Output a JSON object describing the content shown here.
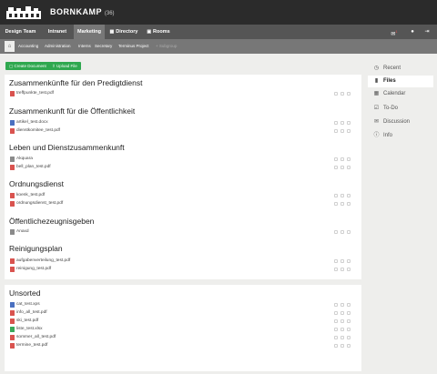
{
  "header": {
    "brand": "BORNKAMP",
    "brand_suffix": "(36)"
  },
  "mainnav": {
    "items": [
      {
        "label": "Design Team"
      },
      {
        "label": "Intranet"
      },
      {
        "label": "Marketing",
        "active": true
      },
      {
        "label": "Directory",
        "icon": "book-icon"
      },
      {
        "label": "Rooms",
        "icon": "rooms-icon"
      }
    ],
    "mail_badge": "1"
  },
  "subnav": {
    "items": [
      {
        "label": "Accounting"
      },
      {
        "label": "Administration"
      },
      {
        "label": "Interns"
      },
      {
        "label": "Secretary"
      },
      {
        "label": "Terminus Project"
      },
      {
        "label": "Subgroup",
        "disabled": true
      }
    ]
  },
  "actions": {
    "create_label": "Create Document",
    "upload_label": "Upload File"
  },
  "groups": [
    {
      "title": "Zusammenkünfte für den Predigtdienst",
      "files": [
        {
          "name": "treffpunkte_test.pdf",
          "type": "pdf"
        }
      ]
    },
    {
      "title": "Zusammenkunft für die Öffentlichkeit",
      "files": [
        {
          "name": "artikel_test.docx",
          "type": "doc"
        },
        {
          "name": "dienstkomitee_test.pdf",
          "type": "pdf"
        }
      ]
    },
    {
      "title": "Leben und Dienstzusammenkunft",
      "files": [
        {
          "name": "Akquara",
          "type": "generic"
        },
        {
          "name": "bell_plan_test.pdf",
          "type": "pdf"
        }
      ]
    },
    {
      "title": "Ordnungsdienst",
      "files": [
        {
          "name": "koenk_test.pdf",
          "type": "pdf"
        },
        {
          "name": "ordnungsdienst_test.pdf",
          "type": "pdf"
        }
      ]
    },
    {
      "title": "Öffentlichezeugnisgeben",
      "files": [
        {
          "name": "Anaxd",
          "type": "generic"
        }
      ]
    },
    {
      "title": "Reinigungsplan",
      "files": [
        {
          "name": "aufgabenverteilung_test.pdf",
          "type": "pdf"
        },
        {
          "name": "reinigung_test.pdf",
          "type": "pdf"
        }
      ]
    }
  ],
  "unsorted": {
    "title": "Unsorted",
    "files": [
      {
        "name": "cat_test.xps",
        "type": "doc"
      },
      {
        "name": "info_all_test.pdf",
        "type": "pdf"
      },
      {
        "name": "ski_test.pdf",
        "type": "pdf"
      },
      {
        "name": "liste_test.xlsx",
        "type": "xls"
      },
      {
        "name": "sommer_all_test.pdf",
        "type": "pdf"
      },
      {
        "name": "termine_test.pdf",
        "type": "pdf"
      }
    ]
  },
  "sidebar": {
    "items": [
      {
        "label": "Recent",
        "icon": "clock-icon"
      },
      {
        "label": "Files",
        "icon": "folder-icon",
        "active": true
      },
      {
        "label": "Calendar",
        "icon": "calendar-icon"
      },
      {
        "label": "To-Do",
        "icon": "checkbox-icon"
      },
      {
        "label": "Discussion",
        "icon": "chat-icon"
      },
      {
        "label": "Info",
        "icon": "info-icon"
      }
    ]
  }
}
